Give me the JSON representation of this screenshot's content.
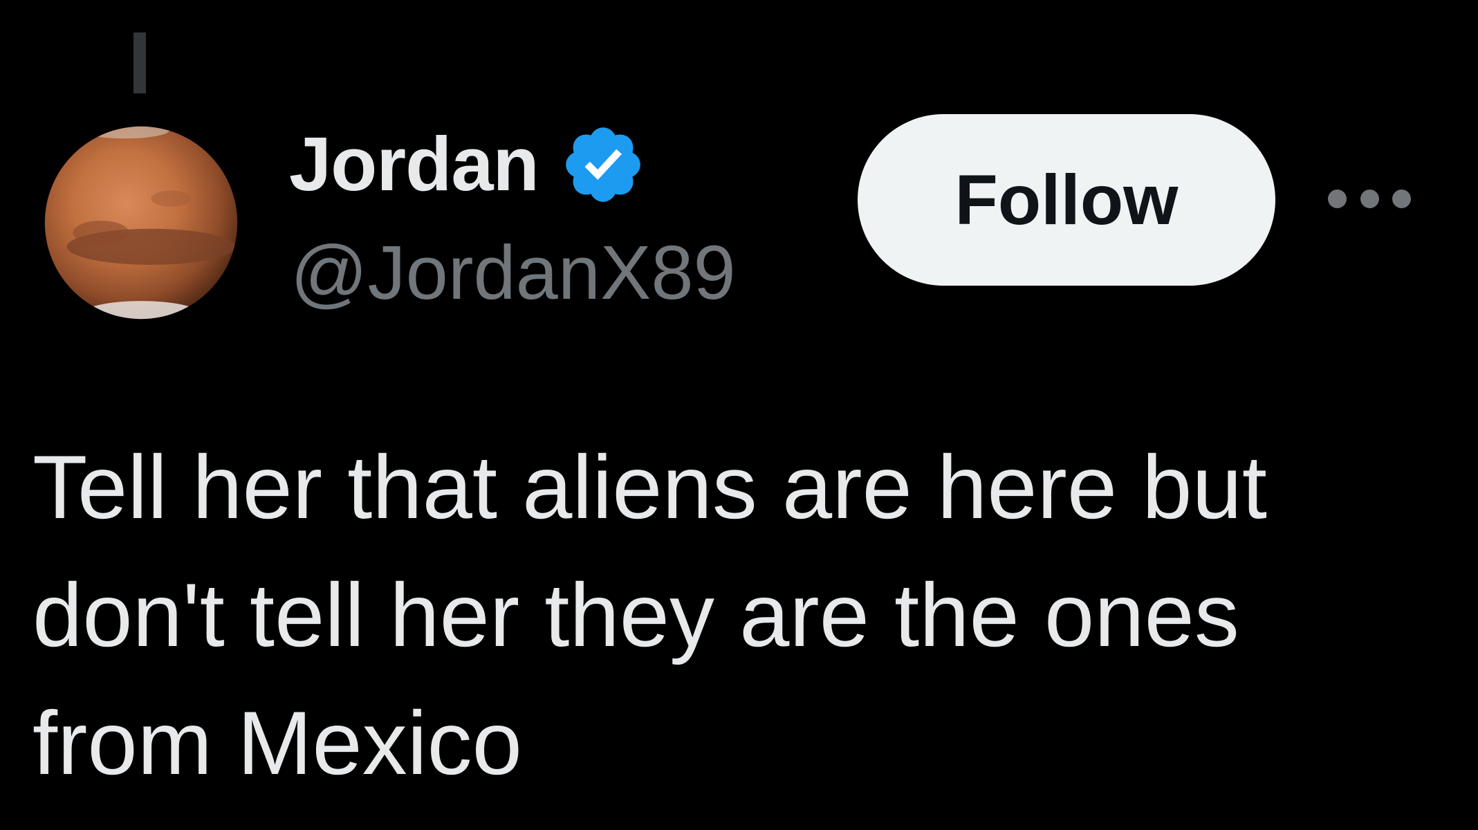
{
  "author": {
    "display_name": "Jordan",
    "handle": "@JordanX89",
    "verified": true,
    "avatar_icon": "mars-planet-avatar",
    "badge_icon": "verified-badge-icon"
  },
  "actions": {
    "follow_label": "Follow",
    "more_icon": "more-options-icon"
  },
  "tweet": {
    "text": "Tell her that aliens are here but\ndon't tell her they are the ones\nfrom Mexico"
  },
  "colors": {
    "background": "#000000",
    "primary_text": "#e7e9ea",
    "secondary_text": "#71767b",
    "verified_blue": "#1d9bf0",
    "follow_button_bg": "#eff3f4",
    "follow_button_text": "#0f1419",
    "thread_line": "#333639"
  }
}
